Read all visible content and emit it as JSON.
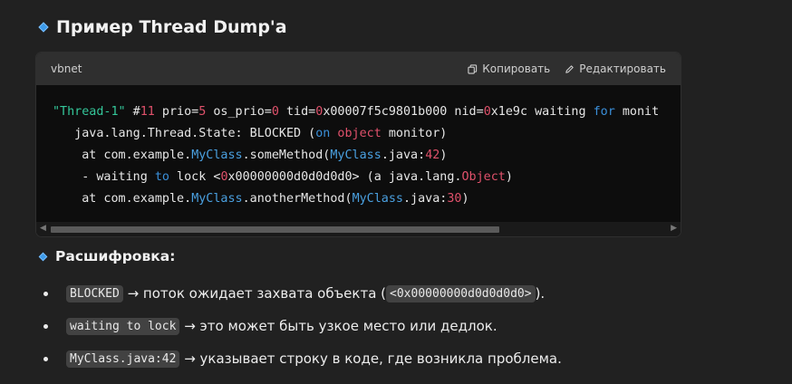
{
  "heading": {
    "title": "Пример Thread Dump'а"
  },
  "code_block": {
    "language": "vbnet",
    "copy_label": "Копировать",
    "edit_label": "Редактировать",
    "lines": {
      "l1": {
        "a": "\"Thread-1\"",
        "b": " #",
        "c": "11",
        "d": " prio=",
        "e": "5",
        "f": " os_prio=",
        "g": "0",
        "h": " tid=",
        "i": "0",
        "j": "x00007f5c9801b000 nid=",
        "k": "0",
        "l": "x1e9c waiting ",
        "m": "for",
        "n": " monit"
      },
      "l2": {
        "a": "   java.lang.Thread.State: BLOCKED (",
        "b": "on",
        "c": " ",
        "d": "object",
        "e": " monitor)"
      },
      "l3": {
        "a": "    at com.example.",
        "b": "MyClass",
        "c": ".someMethod(",
        "d": "MyClass",
        "e": ".java:",
        "f": "42",
        "g": ")"
      },
      "l4": {
        "a": "    - waiting ",
        "b": "to",
        "c": " lock <",
        "d": "0",
        "e": "x00000000d0d0d0d0> (a java.lang.",
        "f": "Object",
        "g": ")"
      },
      "l5": {
        "a": "    at com.example.",
        "b": "MyClass",
        "c": ".anotherMethod(",
        "d": "MyClass",
        "e": ".java:",
        "f": "30",
        "g": ")"
      }
    }
  },
  "section": {
    "title": "Расшифровка:"
  },
  "items": [
    {
      "code": "BLOCKED",
      "text": "→ поток ожидает захвата объекта (",
      "code2": "<0x00000000d0d0d0d0>",
      "tail": ")."
    },
    {
      "code": "waiting to lock",
      "text": "→ это может быть узкое место или дедлок."
    },
    {
      "code": "MyClass.java:42",
      "text": "→ указывает строку в коде, где возникла проблема."
    }
  ],
  "colors": {
    "background": "#212121",
    "code_bg": "#0d0d0d",
    "string": "#34c79a",
    "number": "#e0516b",
    "keyword": "#3a8fd9",
    "type": "#4aa0e0"
  }
}
